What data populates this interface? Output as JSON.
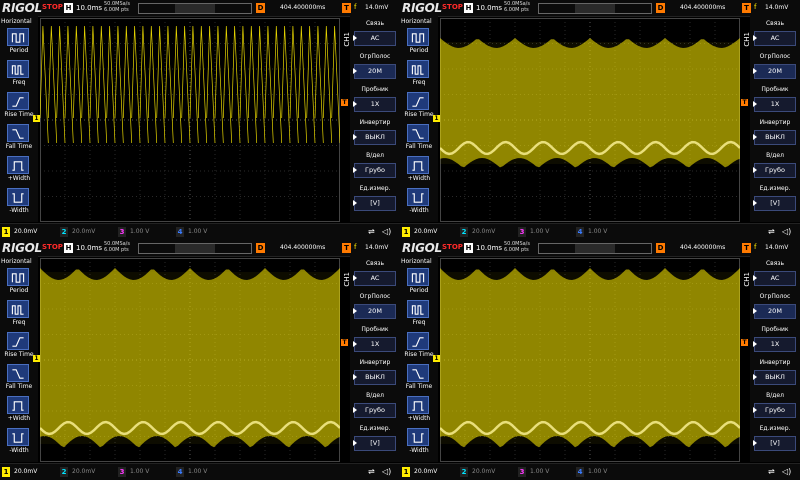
{
  "colors": {
    "ch1": "#ffec00",
    "ch2": "#00e5ff",
    "ch3": "#ff38ff",
    "ch4": "#3a7bff",
    "trigger": "#ff7a00",
    "stop": "#ff2a2a",
    "menu_value_bg": "#151a2e"
  },
  "waveform_modes": [
    "sparse",
    "dense",
    "dense",
    "dense"
  ],
  "topbar": {
    "logo": "RIGOL",
    "status": "STOP",
    "h_badge": "H",
    "timebase": "10.0ms",
    "sample_rate": "50.0MSa/s",
    "mem_depth": "6.00M pts",
    "d_badge": "D",
    "delay": "404.400000ms",
    "t_badge": "T",
    "trigger_slope": "f",
    "trigger_level": "14.0mV"
  },
  "sidebar": {
    "title": "Horizontal",
    "items": [
      {
        "label": "Period",
        "icon": "period-icon"
      },
      {
        "label": "Freq",
        "icon": "frequency-icon"
      },
      {
        "label": "Rise Time",
        "icon": "rise-time-icon"
      },
      {
        "label": "Fall Time",
        "icon": "fall-time-icon"
      },
      {
        "label": "+Width",
        "icon": "positive-width-icon"
      },
      {
        "label": "-Width",
        "icon": "negative-width-icon"
      }
    ]
  },
  "menu": {
    "channel_label": "CH1",
    "items": [
      {
        "label": "Связь",
        "value": "AC"
      },
      {
        "label": "ОгрПолос",
        "value": "20M"
      },
      {
        "label": "Пробник",
        "value": "1X"
      },
      {
        "label": "Инвертир",
        "value": "ВЫКЛ"
      },
      {
        "label": "В/дел",
        "value": "Грубо"
      },
      {
        "label": "Ед.измер.",
        "value": "[V]"
      }
    ]
  },
  "bottombar": {
    "channels": [
      {
        "num": "1",
        "value": "20.0mV"
      },
      {
        "num": "2",
        "value": "20.0mV"
      },
      {
        "num": "3",
        "value": "1.00 V"
      },
      {
        "num": "4",
        "value": "1.00 V"
      }
    ]
  },
  "markers": {
    "ch1": "1",
    "trigger": "T"
  }
}
